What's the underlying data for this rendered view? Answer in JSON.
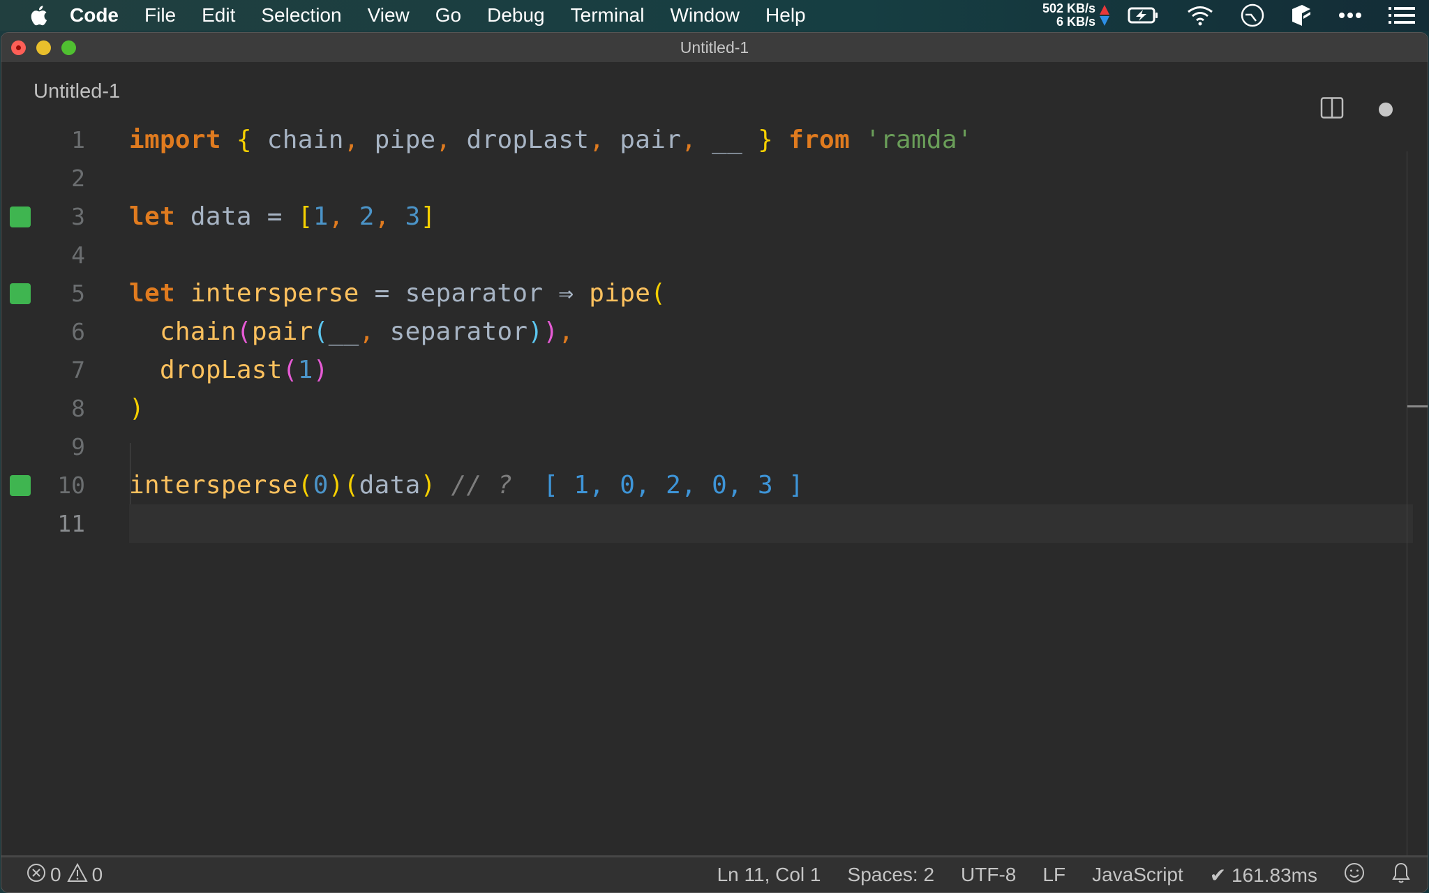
{
  "menubar": {
    "apple_icon": "apple-logo-icon",
    "items": [
      "Code",
      "File",
      "Edit",
      "Selection",
      "View",
      "Go",
      "Debug",
      "Terminal",
      "Window",
      "Help"
    ],
    "network": {
      "upload": "502 KB/s",
      "download": "6 KB/s"
    },
    "status_icons": [
      "battery-charging-icon",
      "wifi-icon",
      "clock-icon",
      "app-cube-icon",
      "more-dots-icon",
      "list-icon"
    ]
  },
  "window": {
    "title": "Untitled-1",
    "tab": {
      "label": "Untitled-1",
      "modified": true
    },
    "actions": [
      "split-editor-icon",
      "unsaved-dot-icon"
    ]
  },
  "editor": {
    "language": "JavaScript",
    "current_line": 11,
    "lines": [
      {
        "n": "1",
        "text": "import { chain, pipe, dropLast, pair, __ } from 'ramda'",
        "mark": false
      },
      {
        "n": "2",
        "text": "",
        "mark": false
      },
      {
        "n": "3",
        "text": "let data = [1, 2, 3]",
        "mark": true
      },
      {
        "n": "4",
        "text": "",
        "mark": false
      },
      {
        "n": "5",
        "text": "let intersperse = separator ⇒ pipe(",
        "mark": true
      },
      {
        "n": "6",
        "text": "  chain(pair(__, separator)),",
        "mark": false
      },
      {
        "n": "7",
        "text": "  dropLast(1)",
        "mark": false
      },
      {
        "n": "8",
        "text": ")",
        "mark": false
      },
      {
        "n": "9",
        "text": "",
        "mark": false
      },
      {
        "n": "10",
        "text": "intersperse(0)(data) // ?  [ 1, 0, 2, 0, 3 ]",
        "mark": true
      },
      {
        "n": "11",
        "text": "",
        "mark": false
      }
    ],
    "tokens": {
      "l1": [
        "import",
        "{",
        "chain",
        ",",
        "pipe",
        ",",
        "dropLast",
        ",",
        "pair",
        ",",
        "__",
        "}",
        "from",
        "'ramda'"
      ],
      "l3": [
        "let",
        "data",
        "=",
        "[",
        "1",
        ",",
        "2",
        ",",
        "3",
        "]"
      ],
      "l5": [
        "let",
        "intersperse",
        "=",
        "separator",
        "⇒",
        "pipe",
        "("
      ],
      "l6": [
        "chain",
        "(",
        "pair",
        "(",
        "__",
        ",",
        "separator",
        ")",
        ")",
        ","
      ],
      "l7": [
        "dropLast",
        "(",
        "1",
        ")"
      ],
      "l8": [
        ")"
      ],
      "l10": [
        "intersperse",
        "(",
        "0",
        ")",
        "(",
        "data",
        ")",
        "// ?",
        "[ 1, 0, 2, 0, 3 ]"
      ]
    },
    "quokka_result": "[ 1, 0, 2, 0, 3 ]",
    "colors": {
      "keyword": "#e07b1f",
      "function": "#fdc15e",
      "identifier": "#a7b4c4",
      "string": "#6a9e59",
      "number": "#4b94c8",
      "bracket_level1": "#f6d000",
      "bracket_level2": "#e65bd5",
      "bracket_level3": "#5cc6ef",
      "coverage_mark": "#3fb550"
    }
  },
  "statusbar": {
    "errors": "0",
    "warnings": "0",
    "position": "Ln 11, Col 1",
    "indent": "Spaces: 2",
    "encoding": "UTF-8",
    "eol": "LF",
    "language": "JavaScript",
    "quokka_time": "✔ 161.83ms",
    "feedback_icon": "smiley-icon",
    "notifications_icon": "bell-icon"
  }
}
